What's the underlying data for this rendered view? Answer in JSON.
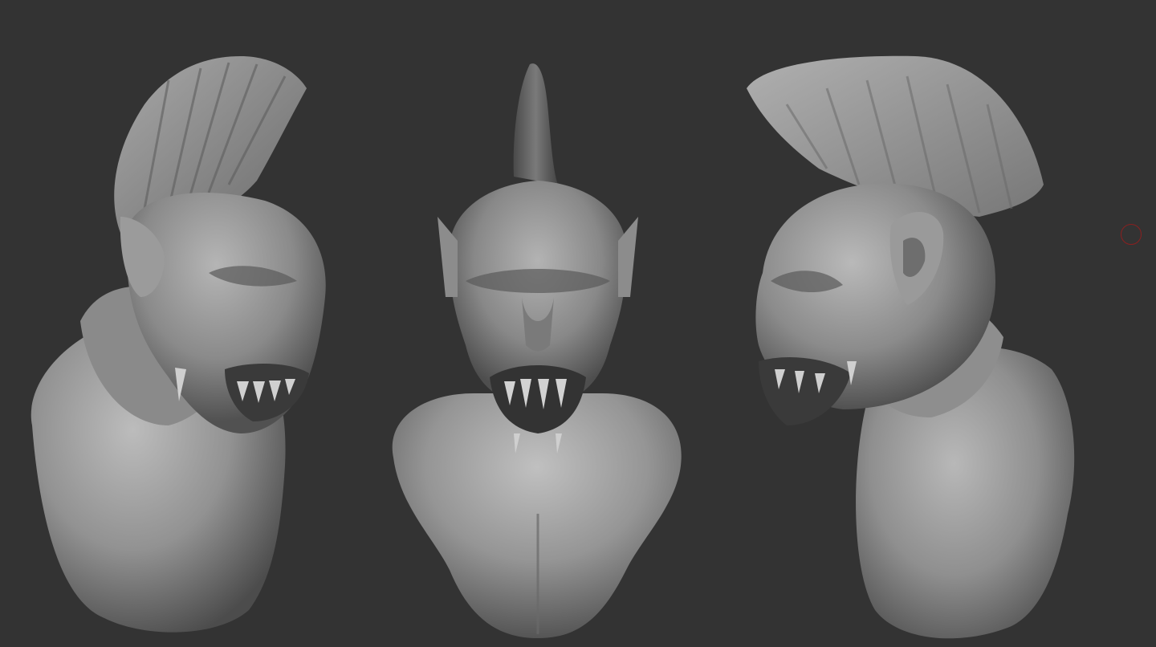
{
  "viewport": {
    "background": "#333333",
    "view_count": 3,
    "views": [
      {
        "name": "left-three-quarter-view",
        "icon": "sculpt-bust"
      },
      {
        "name": "front-view",
        "icon": "sculpt-bust"
      },
      {
        "name": "right-profile-view",
        "icon": "sculpt-bust"
      }
    ]
  },
  "material": {
    "base_color": "#8c8c8c",
    "light_color": "#bdbdbd",
    "shadow_color": "#4a4a4a"
  },
  "cursor": {
    "type": "brush-circle",
    "color": "#8a2020"
  }
}
